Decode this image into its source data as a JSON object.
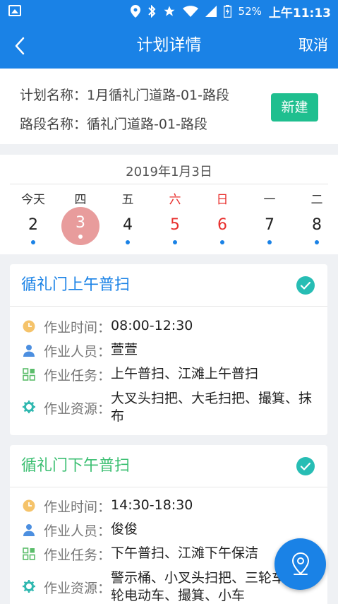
{
  "status_bar": {
    "battery": "52%",
    "time": "上午11:13"
  },
  "header": {
    "title": "计划详情",
    "cancel_label": "取消"
  },
  "plan": {
    "plan_name_label": "计划名称：",
    "plan_name": "1月循礼门道路-01-路段",
    "road_name_label": "路段名称：",
    "road_name": "循礼门道路-01-路段",
    "new_button": "新建"
  },
  "calendar": {
    "date": "2019年1月3日",
    "days": [
      {
        "weekday": "今天",
        "day": "2",
        "weekend": false,
        "selected": false
      },
      {
        "weekday": "四",
        "day": "3",
        "weekend": false,
        "selected": true
      },
      {
        "weekday": "五",
        "day": "4",
        "weekend": false,
        "selected": false
      },
      {
        "weekday": "六",
        "day": "5",
        "weekend": true,
        "selected": false
      },
      {
        "weekday": "日",
        "day": "6",
        "weekend": true,
        "selected": false
      },
      {
        "weekday": "一",
        "day": "7",
        "weekend": false,
        "selected": false
      },
      {
        "weekday": "二",
        "day": "8",
        "weekend": false,
        "selected": false
      }
    ]
  },
  "field_labels": {
    "time": "作业时间：",
    "staff": "作业人员：",
    "task": "作业任务：",
    "resources": "作业资源："
  },
  "tasks": [
    {
      "title": "循礼门上午普扫",
      "time": "08:00-12:30",
      "staff": "萱萱",
      "task": "上午普扫、江滩上午普扫",
      "resources": "大叉头扫把、大毛扫把、撮箕、抹布"
    },
    {
      "title": "循礼门下午普扫",
      "time": "14:30-18:30",
      "staff": "俊俊",
      "task": "下午普扫、江滩下午保洁",
      "resources": "警示桶、小叉头扫把、三轮车、三轮电动车、撮箕、小车"
    }
  ],
  "colors": {
    "primary": "#1a82e6",
    "new_button": "#1fbf8f",
    "check": "#27bdb4",
    "card2_title": "#3cbf72",
    "weekend": "#e8302e",
    "selected_day": "#e89c9c"
  },
  "icons": {
    "time": "clock-icon",
    "staff": "person-icon",
    "task": "grid-icon",
    "resources": "gear-icon",
    "fab": "location-pin-icon"
  }
}
